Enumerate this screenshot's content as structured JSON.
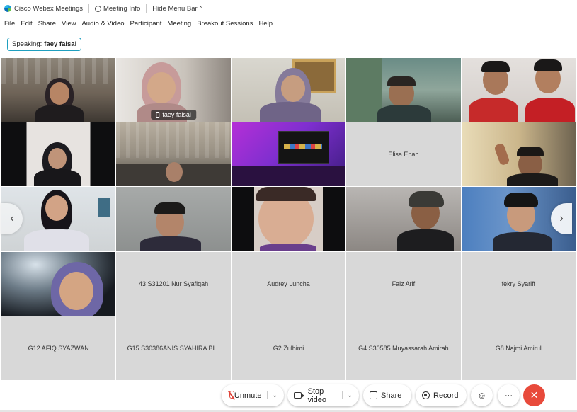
{
  "titlebar": {
    "app_name": "Cisco Webex Meetings",
    "meeting_info": "Meeting Info",
    "hide_menu": "Hide Menu Bar",
    "hide_menu_chevron": "^"
  },
  "menu": [
    "File",
    "Edit",
    "Share",
    "View",
    "Audio & Video",
    "Participant",
    "Meeting",
    "Breakout Sessions",
    "Help"
  ],
  "speaking": {
    "prefix": "Speaking:",
    "name": "faey faisal"
  },
  "participants": [
    {
      "name": "",
      "video": true
    },
    {
      "name": "faey faisal",
      "video": true,
      "active": true
    },
    {
      "name": "",
      "video": true
    },
    {
      "name": "",
      "video": true
    },
    {
      "name": "",
      "video": true
    },
    {
      "name": "",
      "video": true
    },
    {
      "name": "",
      "video": true
    },
    {
      "name": "",
      "video": true
    },
    {
      "name": "Elisa Epah",
      "video": false
    },
    {
      "name": "",
      "video": true
    },
    {
      "name": "",
      "video": true
    },
    {
      "name": "",
      "video": true
    },
    {
      "name": "",
      "video": true
    },
    {
      "name": "",
      "video": true
    },
    {
      "name": "",
      "video": true
    },
    {
      "name": "",
      "video": true
    },
    {
      "name": "43 S31201 Nur Syafiqah",
      "video": false
    },
    {
      "name": "Audrey Luncha",
      "video": false
    },
    {
      "name": "Faiz Arif",
      "video": false
    },
    {
      "name": "fekry Syariff",
      "video": false
    },
    {
      "name": "G12 AFIQ SYAZWAN",
      "video": false
    },
    {
      "name": "G15 S30386ANIS SYAHIRA BI...",
      "video": false
    },
    {
      "name": "G2 Zulhimi",
      "video": false
    },
    {
      "name": "G4 S30585 Muyassarah Amirah",
      "video": false
    },
    {
      "name": "G8 Najmi Amirul",
      "video": false
    }
  ],
  "controls": {
    "unmute": "Unmute",
    "stop_video": "Stop video",
    "share": "Share",
    "record": "Record",
    "more": "···",
    "end": "✕",
    "dropdown": "⌄"
  },
  "nav": {
    "left": "‹",
    "right": "›"
  },
  "colors": {
    "accent": "#18a6d6",
    "end": "#e84a3b",
    "mic_muted": "#e0453a"
  }
}
